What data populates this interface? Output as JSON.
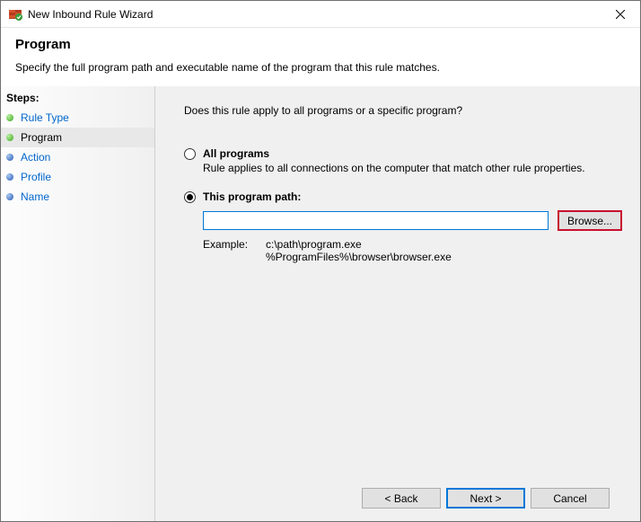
{
  "window": {
    "title": "New Inbound Rule Wizard"
  },
  "header": {
    "title": "Program",
    "description": "Specify the full program path and executable name of the program that this rule matches."
  },
  "sidebar": {
    "steps_label": "Steps:",
    "steps": [
      {
        "label": "Rule Type",
        "state": "done"
      },
      {
        "label": "Program",
        "state": "current"
      },
      {
        "label": "Action",
        "state": "pending"
      },
      {
        "label": "Profile",
        "state": "pending"
      },
      {
        "label": "Name",
        "state": "pending"
      }
    ]
  },
  "main": {
    "question": "Does this rule apply to all programs or a specific program?",
    "option_all": {
      "label": "All programs",
      "desc": "Rule applies to all connections on the computer that match other rule properties.",
      "selected": false
    },
    "option_path": {
      "label": "This program path:",
      "selected": true,
      "value": "",
      "browse_label": "Browse...",
      "example_label": "Example:",
      "example_text": "c:\\path\\program.exe\n%ProgramFiles%\\browser\\browser.exe"
    }
  },
  "buttons": {
    "back": "< Back",
    "next": "Next >",
    "cancel": "Cancel"
  }
}
